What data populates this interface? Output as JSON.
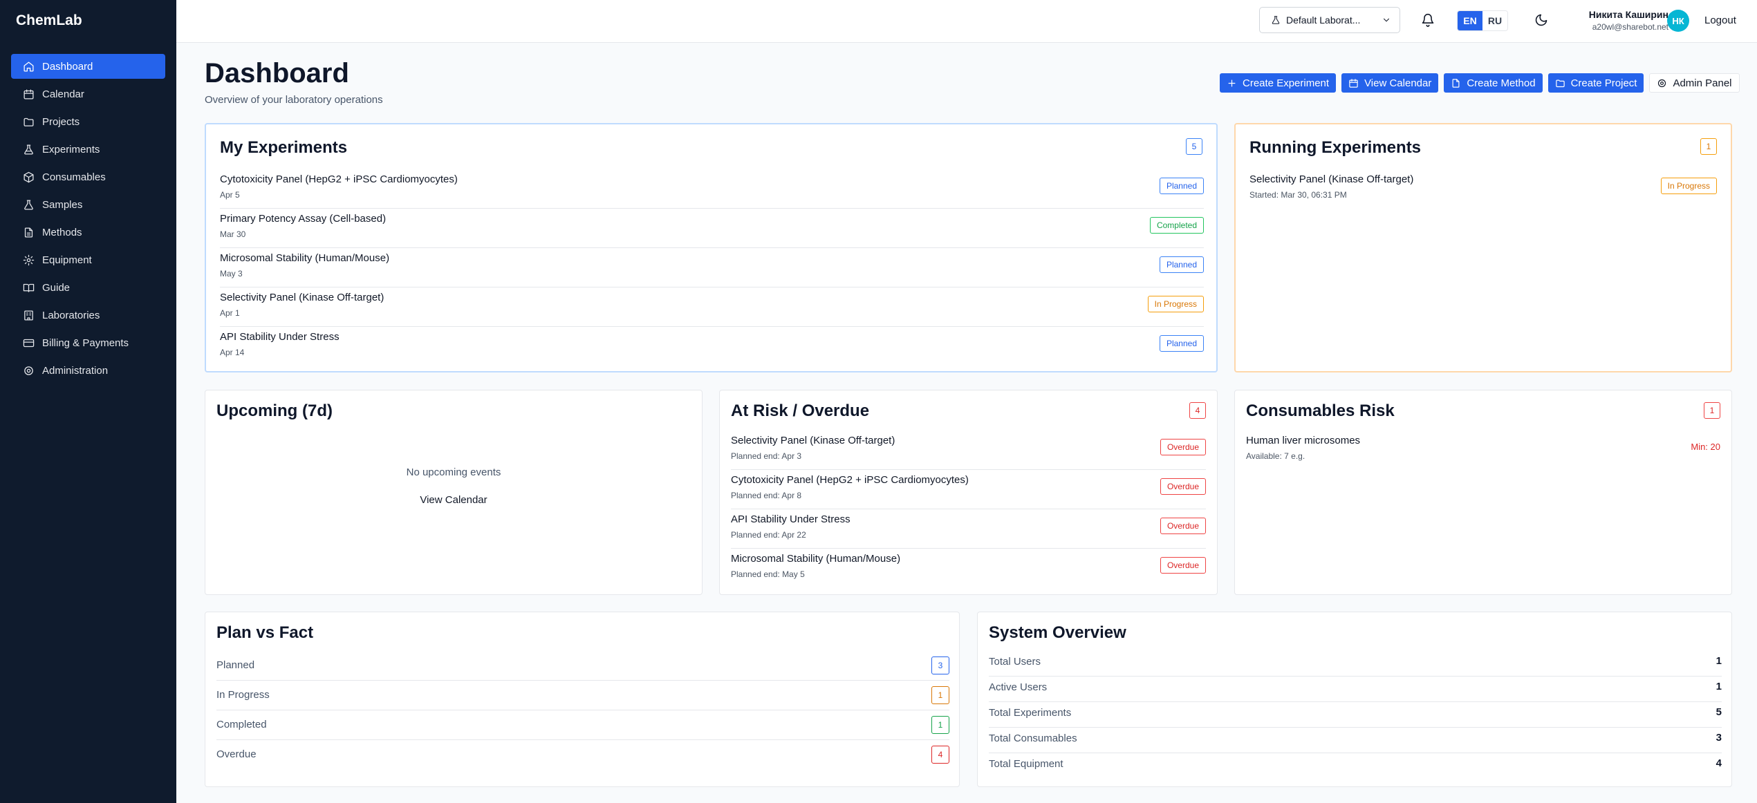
{
  "app": {
    "brand": "ChemLab"
  },
  "sidebar": {
    "items": [
      {
        "label": "Dashboard",
        "icon": "home-icon",
        "active": true
      },
      {
        "label": "Calendar",
        "icon": "calendar-icon"
      },
      {
        "label": "Projects",
        "icon": "folder-icon"
      },
      {
        "label": "Experiments",
        "icon": "flask-icon"
      },
      {
        "label": "Consumables",
        "icon": "box-icon"
      },
      {
        "label": "Samples",
        "icon": "flask-icon"
      },
      {
        "label": "Methods",
        "icon": "document-icon"
      },
      {
        "label": "Equipment",
        "icon": "gear-icon"
      },
      {
        "label": "Guide",
        "icon": "book-icon"
      },
      {
        "label": "Laboratories",
        "icon": "building-icon"
      },
      {
        "label": "Billing & Payments",
        "icon": "credit-card-icon"
      },
      {
        "label": "Administration",
        "icon": "settings-icon"
      }
    ]
  },
  "header": {
    "lab_selector": "Default Laborat...",
    "lang_en": "EN",
    "lang_ru": "RU",
    "user_name": "Никита Каширин",
    "user_email": "a20wl@sharebot.net",
    "avatar_initials": "НК",
    "logout": "Logout",
    "accent": "#2563eb"
  },
  "page": {
    "title": "Dashboard",
    "subtitle": "Overview of your laboratory operations",
    "actions": {
      "create_experiment": "Create Experiment",
      "view_calendar": "View Calendar",
      "create_method": "Create Method",
      "create_project": "Create Project",
      "admin_panel": "Admin Panel"
    }
  },
  "my_experiments": {
    "title": "My Experiments",
    "count": "5",
    "items": [
      {
        "name": "Cytotoxicity Panel (HepG2 + iPSC Cardiomyocytes)",
        "date": "Apr 5",
        "status": "Planned"
      },
      {
        "name": "Primary Potency Assay (Cell-based)",
        "date": "Mar 30",
        "status": "Completed"
      },
      {
        "name": "Microsomal Stability (Human/Mouse)",
        "date": "May 3",
        "status": "Planned"
      },
      {
        "name": "Selectivity Panel (Kinase Off-target)",
        "date": "Apr 1",
        "status": "In Progress"
      },
      {
        "name": "API Stability Under Stress",
        "date": "Apr 14",
        "status": "Planned"
      }
    ]
  },
  "running": {
    "title": "Running Experiments",
    "count": "1",
    "items": [
      {
        "name": "Selectivity Panel (Kinase Off-target)",
        "meta": "Started: Mar 30, 06:31 PM",
        "status": "In Progress"
      }
    ]
  },
  "upcoming": {
    "title": "Upcoming (7d)",
    "empty": "No upcoming events",
    "link": "View Calendar"
  },
  "at_risk": {
    "title": "At Risk / Overdue",
    "count": "4",
    "items": [
      {
        "name": "Selectivity Panel (Kinase Off-target)",
        "meta": "Planned end: Apr 3",
        "status": "Overdue"
      },
      {
        "name": "Cytotoxicity Panel (HepG2 + iPSC Cardiomyocytes)",
        "meta": "Planned end: Apr 8",
        "status": "Overdue"
      },
      {
        "name": "API Stability Under Stress",
        "meta": "Planned end: Apr 22",
        "status": "Overdue"
      },
      {
        "name": "Microsomal Stability (Human/Mouse)",
        "meta": "Planned end: May 5",
        "status": "Overdue"
      }
    ]
  },
  "consumables_risk": {
    "title": "Consumables Risk",
    "count": "1",
    "items": [
      {
        "name": "Human liver microsomes",
        "meta": "Available: 7 e.g.",
        "min": "Min: 20"
      }
    ]
  },
  "plan_vs_fact": {
    "title": "Plan vs Fact",
    "rows": [
      {
        "label": "Planned",
        "count": "3"
      },
      {
        "label": "In Progress",
        "count": "1"
      },
      {
        "label": "Completed",
        "count": "1"
      },
      {
        "label": "Overdue",
        "count": "4"
      }
    ]
  },
  "system_overview": {
    "title": "System Overview",
    "rows": [
      {
        "label": "Total Users",
        "value": "1"
      },
      {
        "label": "Active Users",
        "value": "1"
      },
      {
        "label": "Total Experiments",
        "value": "5"
      },
      {
        "label": "Total Consumables",
        "value": "3"
      },
      {
        "label": "Total Equipment",
        "value": "4"
      }
    ]
  }
}
